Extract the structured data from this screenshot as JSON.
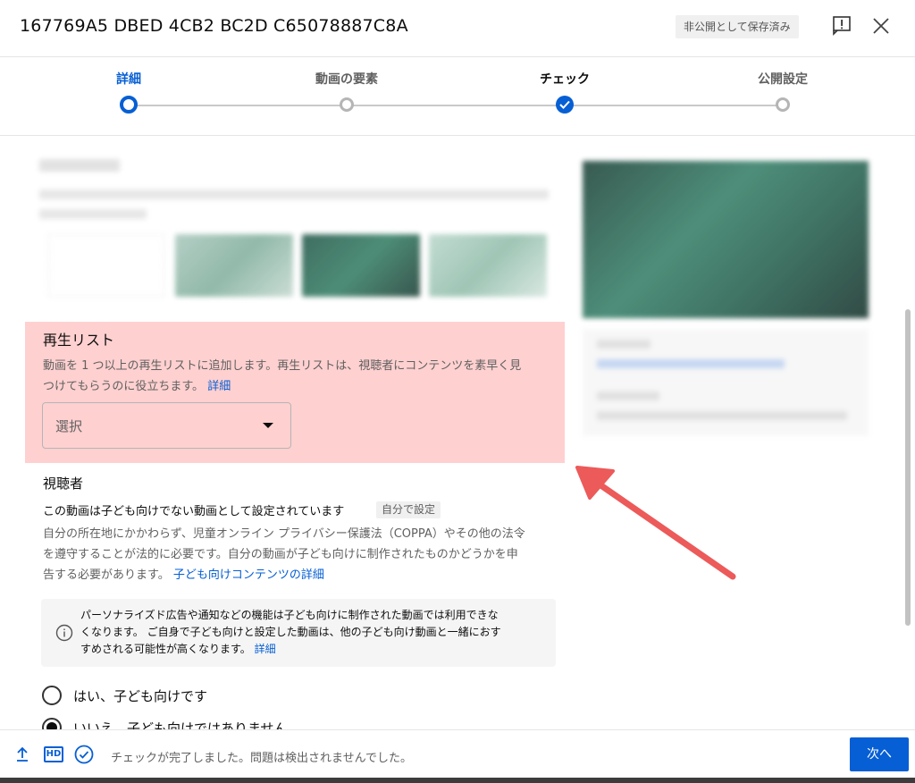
{
  "header": {
    "title": "167769A5 DBED 4CB2 BC2D C65078887C8A",
    "saved_badge": "非公開として保存済み"
  },
  "stepper": {
    "steps": [
      {
        "label": "詳細",
        "state": "active"
      },
      {
        "label": "動画の要素",
        "state": "pending"
      },
      {
        "label": "チェック",
        "state": "done"
      },
      {
        "label": "公開設定",
        "state": "pending"
      }
    ]
  },
  "playlist": {
    "title": "再生リスト",
    "description_line1": "動画を 1 つ以上の再生リストに追加します。再生リストは、視聴者にコンテンツを素早く見",
    "description_line2": "つけてもらうのに役立ちます。",
    "details_link": "詳細",
    "select_placeholder": "選択"
  },
  "audience": {
    "title": "視聴者",
    "status": "この動画は子ども向けでない動画として設定されています",
    "status_badge": "自分で設定",
    "desc_line1": "自分の所在地にかかわらず、児童オンライン プライバシー保護法（COPPA）やその他の法令",
    "desc_line2": "を遵守することが法的に必要です。自分の動画が子ども向けに制作されたものかどうかを申",
    "desc_line3": "告する必要があります。",
    "desc_link": "子ども向けコンテンツの詳細",
    "info_line1": "パーソナライズド広告や通知などの機能は子ども向けに制作された動画では利用できな",
    "info_line2": "くなります。 ご自身で子ども向けと設定した動画は、他の子ども向け動画と一緒におす",
    "info_line3": "すめされる可能性が高くなります。",
    "info_link": "詳細",
    "option_yes": "はい、子ども向けです",
    "option_no": "いいえ、子ども向けではありません",
    "selected": "no"
  },
  "footer": {
    "status": "チェックが完了しました。問題は検出されませんでした。",
    "next_label": "次へ",
    "hd_label": "HD"
  },
  "colors": {
    "accent": "#065fd4",
    "highlight": "#ffd0d0",
    "annotation_arrow": "#ec5a5a"
  },
  "icons": [
    "upload-icon",
    "hd-icon",
    "check-circle-icon",
    "feedback-icon",
    "close-icon",
    "info-icon",
    "dropdown-caret-icon"
  ]
}
